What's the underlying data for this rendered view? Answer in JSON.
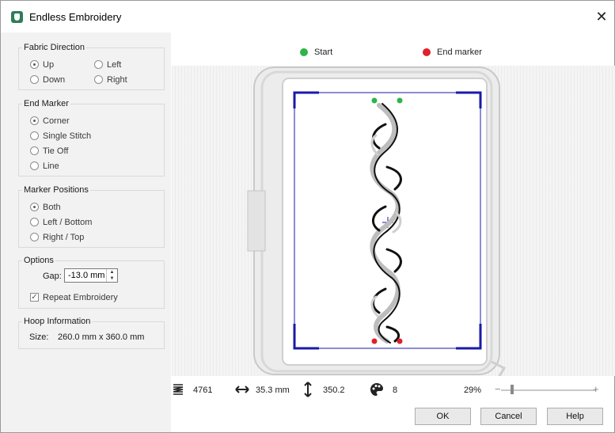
{
  "window": {
    "title": "Endless Embroidery",
    "close_glyph": "✕"
  },
  "fabric_direction": {
    "title": "Fabric Direction",
    "options": [
      "Up",
      "Left",
      "Down",
      "Right"
    ],
    "selected": "Up"
  },
  "end_marker": {
    "title": "End Marker",
    "options": [
      "Corner",
      "Single Stitch",
      "Tie Off",
      "Line"
    ],
    "selected": "Corner"
  },
  "marker_positions": {
    "title": "Marker Positions",
    "options": [
      "Both",
      "Left / Bottom",
      "Right / Top"
    ],
    "selected": "Both"
  },
  "options": {
    "title": "Options",
    "gap_label": "Gap:",
    "gap_value": "-13.0 mm",
    "repeat_label": "Repeat Embroidery",
    "repeat_checked": true
  },
  "hoop": {
    "title": "Hoop Information",
    "size_label": "Size:",
    "size_value": "260.0 mm x 360.0 mm"
  },
  "legend": {
    "start_label": "Start",
    "start_color": "#2db54a",
    "end_label": "End marker",
    "end_color": "#e0202c"
  },
  "status": {
    "stitches": "4761",
    "width": "35.3 mm",
    "height": "350.2",
    "colors": "8",
    "zoom": "29%",
    "zoom_minus": "−",
    "zoom_plus": "+"
  },
  "buttons": {
    "ok": "OK",
    "cancel": "Cancel",
    "help": "Help"
  },
  "colors": {
    "frame_blue": "#1a1aa8",
    "panel_bg": "#f2f2f2"
  }
}
